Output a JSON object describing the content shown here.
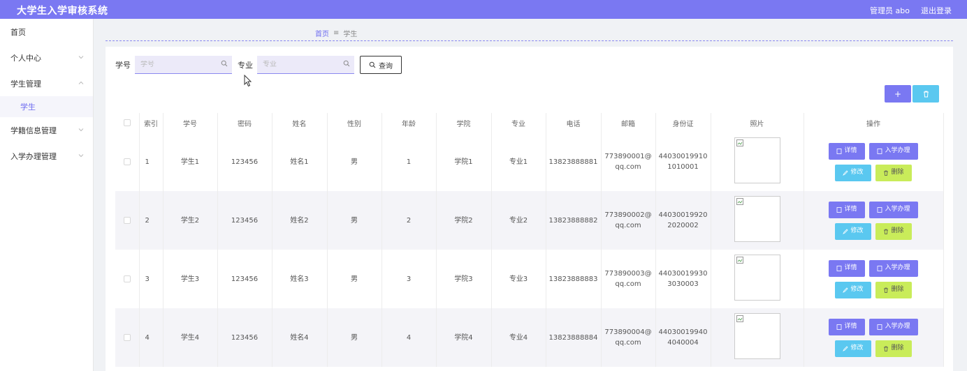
{
  "app": {
    "title": "大学生入学审核系统"
  },
  "topbar": {
    "user_label": "管理员 abo",
    "logout_label": "退出登录"
  },
  "sidebar": {
    "items": [
      {
        "label": "首页",
        "has_chevron": false
      },
      {
        "label": "个人中心",
        "has_chevron": true
      },
      {
        "label": "学生管理",
        "has_chevron": true,
        "expanded": true,
        "children": [
          {
            "label": "学生",
            "active": true
          }
        ]
      },
      {
        "label": "学籍信息管理",
        "has_chevron": true
      },
      {
        "label": "入学办理管理",
        "has_chevron": true
      }
    ]
  },
  "breadcrumb": {
    "home": "首页",
    "separator": "≡",
    "current": "学生"
  },
  "search": {
    "student_no_label": "学号",
    "student_no_placeholder": "学号",
    "major_label": "专业",
    "major_placeholder": "专业",
    "query_label": "查询"
  },
  "actions": {
    "add_icon": "+",
    "delete_icon": "trash-icon"
  },
  "table": {
    "headers": [
      "索引",
      "学号",
      "密码",
      "姓名",
      "性别",
      "年龄",
      "学院",
      "专业",
      "电话",
      "邮箱",
      "身份证",
      "照片",
      "操作"
    ],
    "rows": [
      {
        "index": "1",
        "student_no": "学生1",
        "password": "123456",
        "name": "姓名1",
        "gender": "男",
        "age": "1",
        "college": "学院1",
        "major": "专业1",
        "phone": "13823888881",
        "email_line1": "773890001@",
        "email_line2": "qq.com",
        "id_line1": "44030019910",
        "id_line2": "1010001"
      },
      {
        "index": "2",
        "student_no": "学生2",
        "password": "123456",
        "name": "姓名2",
        "gender": "男",
        "age": "2",
        "college": "学院2",
        "major": "专业2",
        "phone": "13823888882",
        "email_line1": "773890002@",
        "email_line2": "qq.com",
        "id_line1": "44030019920",
        "id_line2": "2020002"
      },
      {
        "index": "3",
        "student_no": "学生3",
        "password": "123456",
        "name": "姓名3",
        "gender": "男",
        "age": "3",
        "college": "学院3",
        "major": "专业3",
        "phone": "13823888883",
        "email_line1": "773890003@",
        "email_line2": "qq.com",
        "id_line1": "44030019930",
        "id_line2": "3030003"
      },
      {
        "index": "4",
        "student_no": "学生4",
        "password": "123456",
        "name": "姓名4",
        "gender": "男",
        "age": "4",
        "college": "学院4",
        "major": "专业4",
        "phone": "13823888884",
        "email_line1": "773890004@",
        "email_line2": "qq.com",
        "id_line1": "44030019940",
        "id_line2": "4040004"
      }
    ],
    "row_actions": {
      "detail": "详情",
      "admit": "入学办理",
      "edit": "修改",
      "delete": "删除"
    }
  },
  "colors": {
    "accent": "#7a78f2",
    "info": "#5ac8f0",
    "success": "#c9ec5a"
  }
}
